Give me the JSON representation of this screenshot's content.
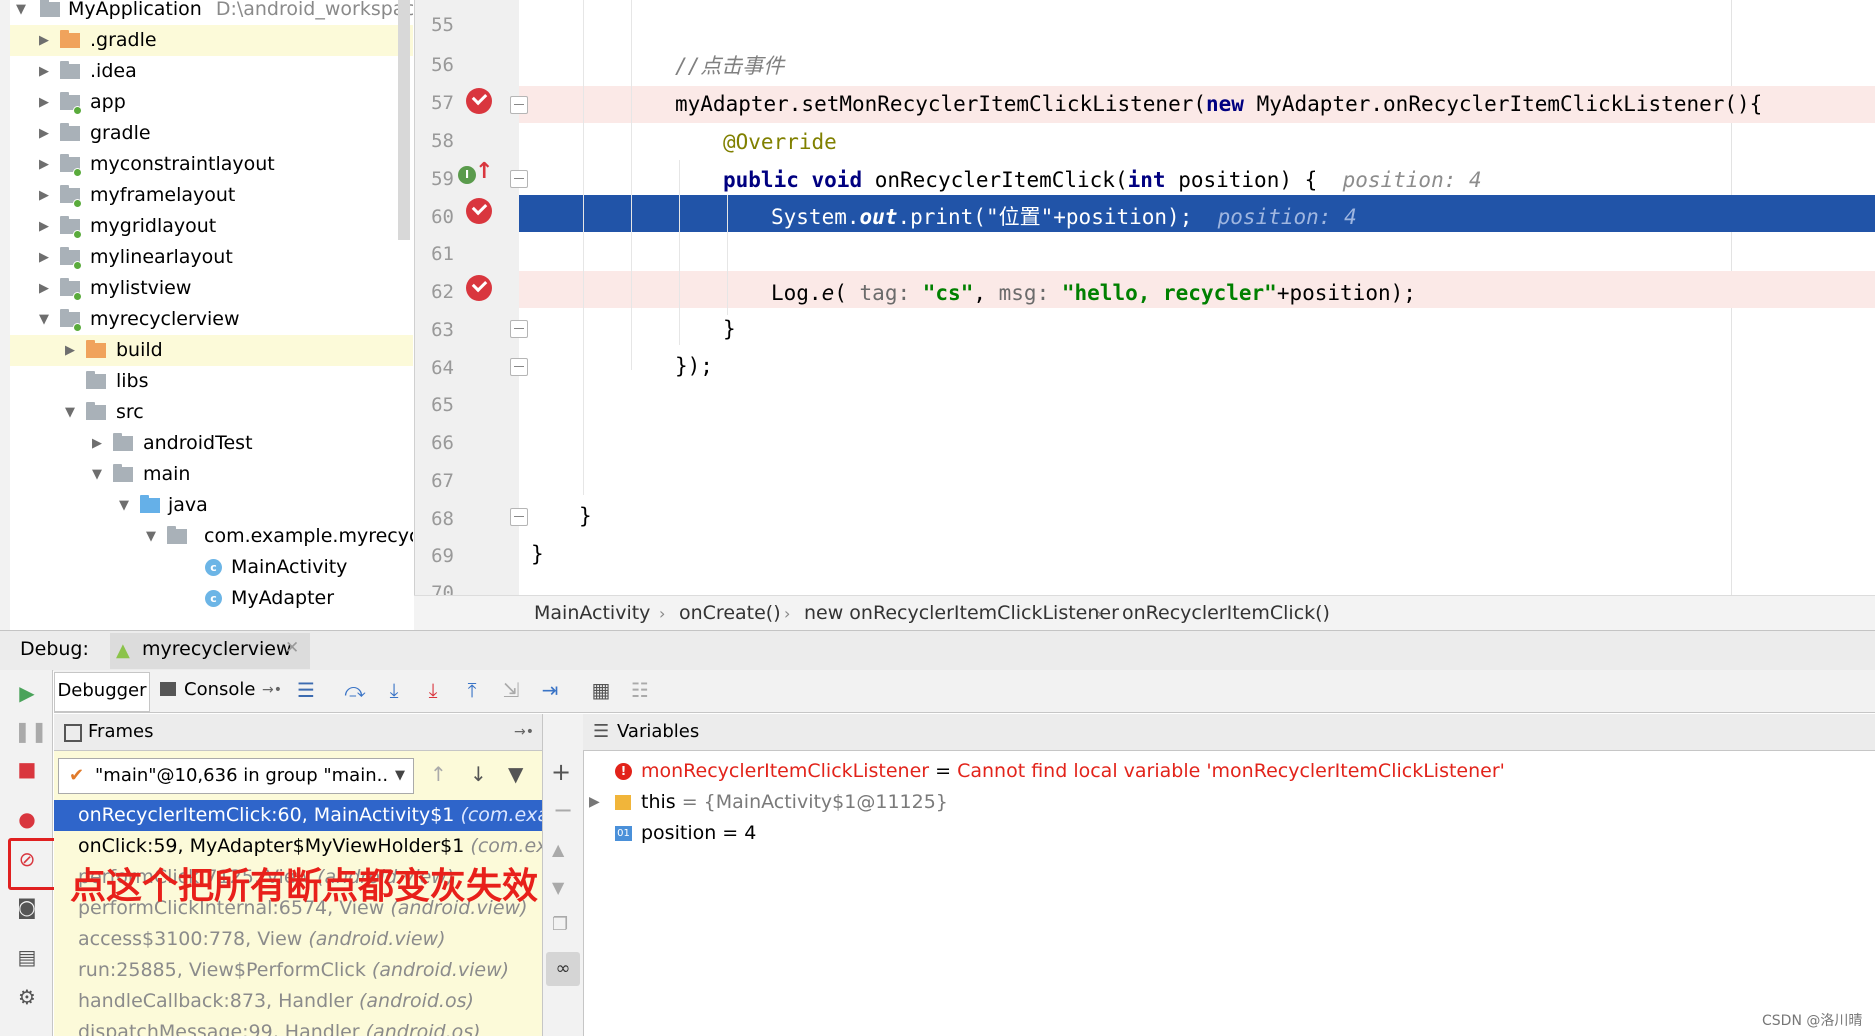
{
  "project_tree": {
    "root_name": "MyApplication",
    "root_path": "D:\\android_workspace\\",
    "items": [
      {
        "label": ".gradle"
      },
      {
        "label": ".idea"
      },
      {
        "label": "app"
      },
      {
        "label": "gradle"
      },
      {
        "label": "myconstraintlayout"
      },
      {
        "label": "myframelayout"
      },
      {
        "label": "mygridlayout"
      },
      {
        "label": "mylinearlayout"
      },
      {
        "label": "mylistview"
      },
      {
        "label": "myrecyclerview"
      },
      {
        "label": "build"
      },
      {
        "label": "libs"
      },
      {
        "label": "src"
      },
      {
        "label": "androidTest"
      },
      {
        "label": "main"
      },
      {
        "label": "java"
      },
      {
        "label": "com.example.myrecycler"
      },
      {
        "label": "MainActivity"
      },
      {
        "label": "MyAdapter"
      }
    ]
  },
  "editor": {
    "line_numbers": [
      "55",
      "56",
      "57",
      "58",
      "59",
      "60",
      "61",
      "62",
      "63",
      "64",
      "65",
      "66",
      "67",
      "68",
      "69",
      "70"
    ],
    "line56_comment": "//点击事件",
    "line57": {
      "a": "myAdapter.setMonRecyclerItemClickListener(",
      "kw": "new",
      "b": " MyAdapter.onRecyclerItemClickListener(){"
    },
    "line58": "@Override",
    "line59": {
      "kw1": "public",
      "kw2": "void",
      "name": " onRecyclerItemClick(",
      "kw3": "int",
      "rest": " position) {",
      "hint": "position: 4"
    },
    "line60": {
      "a": "System.",
      "field": "out",
      "b": ".print(",
      "str": "\"位置\"",
      "c": "+position);",
      "hint": "position: 4"
    },
    "line62": {
      "a": "Log.",
      "method": "e",
      "b": "( ",
      "p1": "tag:",
      "s1": "\"cs\"",
      "sep": ", ",
      "p2": "msg:",
      "s2": "\"hello, recycler\"",
      "c": "+position);"
    },
    "line63": "}",
    "line64": "});",
    "line68": "}",
    "line69": "}"
  },
  "breadcrumbs": [
    "MainActivity",
    "onCreate()",
    "new onRecyclerItemClickListener",
    "onRecyclerItemClick()"
  ],
  "debug": {
    "label": "Debug:",
    "session": "myrecyclerview",
    "tabs": {
      "debugger": "Debugger",
      "console": "Console"
    },
    "frames_title": "Frames",
    "thread": "\"main\"@10,636 in group \"main..",
    "frames": [
      {
        "method": "onRecyclerItemClick:60, MainActivity$1",
        "pkg": "(com.example"
      },
      {
        "method": "onClick:59, MyAdapter$MyViewHolder$1",
        "pkg": "(com.examp"
      },
      {
        "method": "performClick:7125, View",
        "pkg": "(android.view)"
      },
      {
        "method": "performClickInternal:6574, View",
        "pkg": "(android.view)"
      },
      {
        "method": "access$3100:778, View",
        "pkg": "(android.view)"
      },
      {
        "method": "run:25885, View$PerformClick",
        "pkg": "(android.view)"
      },
      {
        "method": "handleCallback:873, Handler",
        "pkg": "(android.os)"
      },
      {
        "method": "dispatchMessage:99, Handler",
        "pkg": "(android.os)"
      }
    ],
    "variables_title": "Variables",
    "variables": [
      {
        "name": "monRecyclerItemClickListener",
        "eq": " = ",
        "value": "Cannot find local variable 'monRecyclerItemClickListener'"
      },
      {
        "name": "this",
        "eq": " = ",
        "value": "{MainActivity$1@11125}"
      },
      {
        "name": "position",
        "eq": " = ",
        "value": "4"
      }
    ]
  },
  "annotation": "点这个把所有断点都变灰失效",
  "watermark": "CSDN @洛川晴",
  "colors": {
    "accent": "#2154a8",
    "breakpoint": "#d9363e",
    "annotation": "#e8201a"
  }
}
